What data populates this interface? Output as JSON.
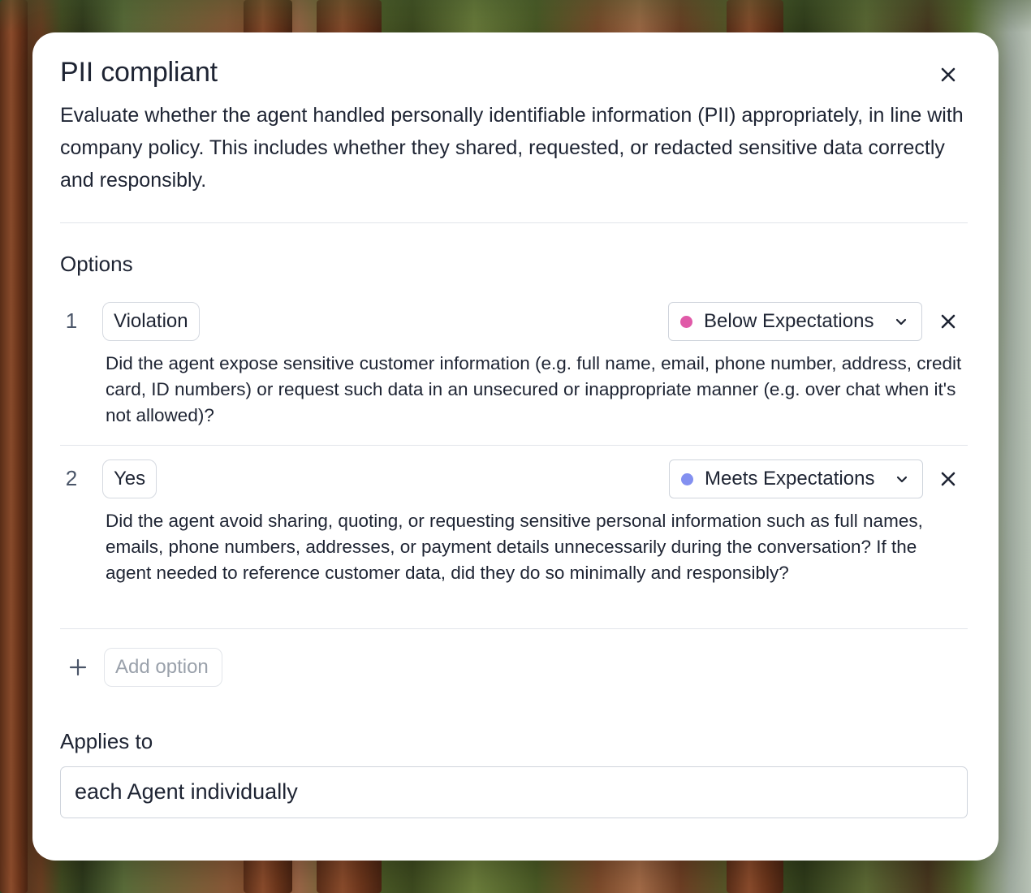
{
  "dialog": {
    "title": "PII compliant",
    "description": "Evaluate whether the agent handled personally identifiable information (PII) appropriately, in line with company policy. This includes whether they shared, requested, or redacted sensitive data correctly and responsibly.",
    "close_icon": "close-icon"
  },
  "options_section": {
    "label": "Options",
    "items": [
      {
        "number": "1",
        "name": "Violation",
        "rating": "Below Expectations",
        "rating_color": "#e05aa8",
        "description": "Did the agent expose sensitive customer information (e.g. full name, email, phone number, address, credit card, ID numbers) or request such data in an unsecured or inappropriate manner (e.g. over chat when it's not allowed)?"
      },
      {
        "number": "2",
        "name": "Yes",
        "rating": "Meets Expectations",
        "rating_color": "#8390f0",
        "description": "Did the agent avoid sharing, quoting, or requesting sensitive personal information such as full names, emails, phone numbers, addresses, or payment details unnecessarily during the conversation? If the agent needed to reference customer data, did they do so minimally and responsibly?"
      }
    ],
    "add_option_placeholder": "Add option"
  },
  "applies_to": {
    "label": "Applies to",
    "value": "each Agent individually"
  },
  "colors": {
    "text": "#1e2433",
    "border": "#cfd4dc",
    "divider": "#e2e5ea",
    "placeholder": "#9aa1ab"
  }
}
